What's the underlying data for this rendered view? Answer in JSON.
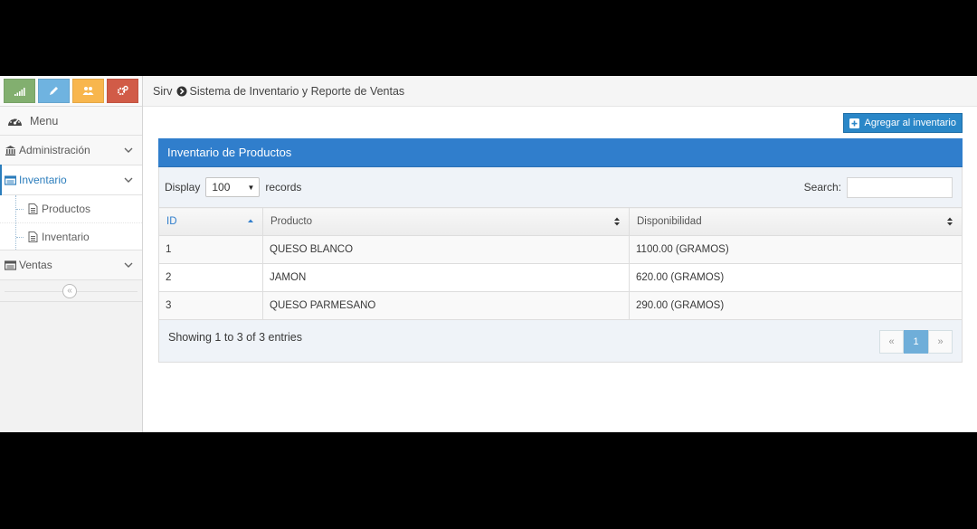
{
  "colors": {
    "accent": "#307ecc",
    "shortcut_green": "#82af6f",
    "shortcut_blue": "#6fb3e0",
    "shortcut_orange": "#f8b64d",
    "shortcut_red": "#d15b47"
  },
  "shortcuts": [
    {
      "icon": "signal-icon"
    },
    {
      "icon": "pencil-icon"
    },
    {
      "icon": "users-icon"
    },
    {
      "icon": "cogs-icon"
    }
  ],
  "sidebar": {
    "menu_label": "Menu",
    "items": [
      {
        "label": "Administración",
        "icon": "bank-icon"
      },
      {
        "label": "Inventario",
        "icon": "list-icon",
        "active": true
      },
      {
        "label": "Ventas",
        "icon": "list-icon"
      }
    ],
    "subitems": [
      {
        "label": "Productos",
        "icon": "file-icon"
      },
      {
        "label": "Inventario",
        "icon": "file-icon"
      }
    ]
  },
  "breadcrumb": {
    "home": "Sirv",
    "current": "Sistema de Inventario y Reporte de Ventas"
  },
  "actions": {
    "add_label": "Agregar al inventario"
  },
  "panel": {
    "title": "Inventario de Productos",
    "display_label": "Display",
    "display_value": "100",
    "records_label": "records",
    "search_label": "Search:",
    "search_value": ""
  },
  "table": {
    "columns": [
      "ID",
      "Producto",
      "Disponibilidad"
    ],
    "rows": [
      [
        "1",
        "QUESO BLANCO",
        "1100.00 (GRAMOS)"
      ],
      [
        "2",
        "JAMON",
        "620.00 (GRAMOS)"
      ],
      [
        "3",
        "QUESO PARMESANO",
        "290.00 (GRAMOS)"
      ]
    ]
  },
  "footer": {
    "info": "Showing 1 to 3 of 3 entries",
    "pager": {
      "prev": "«",
      "page": "1",
      "next": "»"
    }
  }
}
